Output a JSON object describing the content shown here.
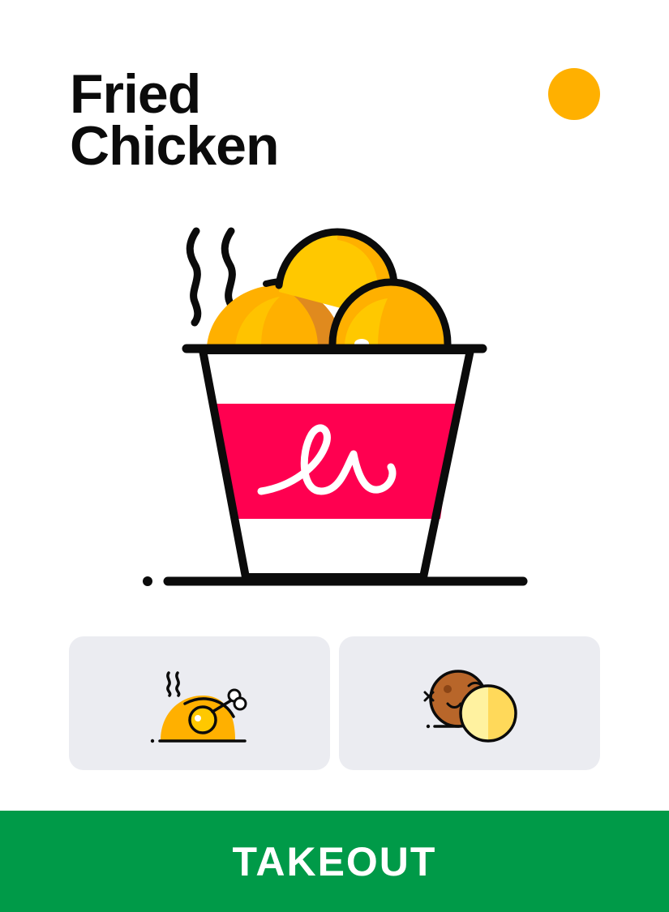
{
  "title": {
    "line1": "Fried",
    "line2": "Chicken"
  },
  "colors": {
    "accent_dot": "#ffb000",
    "brand_band": "#ff0050",
    "card_bg": "#ebecf1",
    "cta_bg": "#009a48"
  },
  "hero": {
    "icon": "fried-chicken-bucket-icon"
  },
  "options": [
    {
      "icon": "roast-chicken-icon"
    },
    {
      "icon": "nuggets-icon"
    }
  ],
  "cta": {
    "label": "TAKEOUT"
  }
}
